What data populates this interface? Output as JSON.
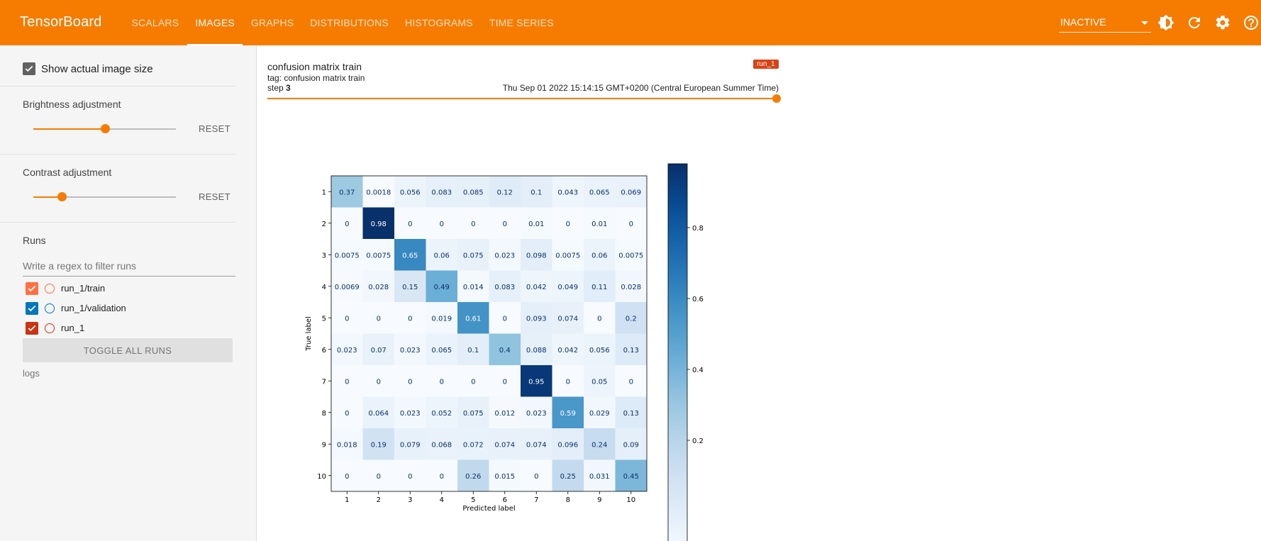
{
  "header": {
    "brand": "TensorBoard",
    "tabs": [
      {
        "label": "SCALARS",
        "active": false
      },
      {
        "label": "IMAGES",
        "active": true
      },
      {
        "label": "GRAPHS",
        "active": false
      },
      {
        "label": "DISTRIBUTIONS",
        "active": false
      },
      {
        "label": "HISTOGRAMS",
        "active": false
      },
      {
        "label": "TIME SERIES",
        "active": false
      }
    ],
    "plugin_select": "INACTIVE",
    "icons": [
      "brightness-icon",
      "refresh-icon",
      "settings-icon",
      "help-icon"
    ]
  },
  "sidebar": {
    "show_actual_size_label": "Show actual image size",
    "show_actual_size_checked": true,
    "brightness_title": "Brightness adjustment",
    "brightness_value": 0.5,
    "contrast_title": "Contrast adjustment",
    "contrast_value": 0.2,
    "reset_label": "RESET",
    "runs_title": "Runs",
    "filter_placeholder": "Write a regex to filter runs",
    "runs": [
      {
        "label": "run_1/train",
        "color": "#ff7043",
        "checked": true
      },
      {
        "label": "run_1/validation",
        "color": "#0077bb",
        "checked": true
      },
      {
        "label": "run_1",
        "color": "#cc3311",
        "checked": true
      }
    ],
    "toggle_all_label": "TOGGLE ALL RUNS",
    "logdir": "logs"
  },
  "card": {
    "title": "confusion matrix train",
    "tag": "tag: confusion matrix train",
    "step_label": "step ",
    "step_value": "3",
    "timestamp": "Thu Sep 01 2022 15:14:15 GMT+0200 (Central European Summer Time)",
    "run_badge": "run_1",
    "accent": "#f57c00"
  },
  "chart_data": {
    "type": "heatmap",
    "xlabel": "Predicted label",
    "ylabel": "True label",
    "x_categories": [
      "1",
      "2",
      "3",
      "4",
      "5",
      "6",
      "7",
      "8",
      "9",
      "10"
    ],
    "y_categories": [
      "1",
      "2",
      "3",
      "4",
      "5",
      "6",
      "7",
      "8",
      "9",
      "10"
    ],
    "values": [
      [
        "0.37",
        "0.0018",
        "0.056",
        "0.083",
        "0.085",
        "0.12",
        "0.1",
        "0.043",
        "0.065",
        "0.069"
      ],
      [
        "0",
        "0.98",
        "0",
        "0",
        "0",
        "0",
        "0.01",
        "0",
        "0.01",
        "0"
      ],
      [
        "0.0075",
        "0.0075",
        "0.65",
        "0.06",
        "0.075",
        "0.023",
        "0.098",
        "0.0075",
        "0.06",
        "0.0075"
      ],
      [
        "0.0069",
        "0.028",
        "0.15",
        "0.49",
        "0.014",
        "0.083",
        "0.042",
        "0.049",
        "0.11",
        "0.028"
      ],
      [
        "0",
        "0",
        "0",
        "0.019",
        "0.61",
        "0",
        "0.093",
        "0.074",
        "0",
        "0.2"
      ],
      [
        "0.023",
        "0.07",
        "0.023",
        "0.065",
        "0.1",
        "0.4",
        "0.088",
        "0.042",
        "0.056",
        "0.13"
      ],
      [
        "0",
        "0",
        "0",
        "0",
        "0",
        "0",
        "0.95",
        "0",
        "0.05",
        "0"
      ],
      [
        "0",
        "0.064",
        "0.023",
        "0.052",
        "0.075",
        "0.012",
        "0.023",
        "0.59",
        "0.029",
        "0.13"
      ],
      [
        "0.018",
        "0.19",
        "0.079",
        "0.068",
        "0.072",
        "0.074",
        "0.074",
        "0.096",
        "0.24",
        "0.09"
      ],
      [
        "0",
        "0",
        "0",
        "0",
        "0.26",
        "0.015",
        "0",
        "0.25",
        "0.031",
        "0.45"
      ]
    ],
    "colorbar_ticks": [
      "0.8",
      "0.6",
      "0.4",
      "0.2"
    ],
    "colorbar_range": [
      0,
      0.98
    ],
    "colormap": "Blues"
  }
}
